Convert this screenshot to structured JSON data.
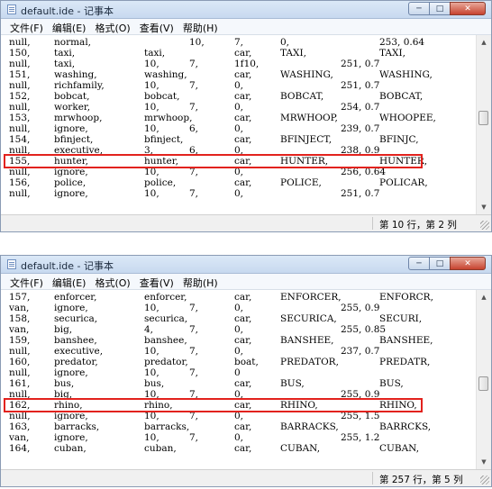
{
  "windows": [
    {
      "title": "default.ide - 记事本",
      "menu": [
        "文件(F)",
        "编辑(E)",
        "格式(O)",
        "查看(V)",
        "帮助(H)"
      ],
      "status": "第 10 行，第 2 列",
      "highlight_row_index": 11,
      "rows": [
        [
          "null,",
          "normal,",
          "",
          "10,",
          "7,",
          "0,",
          "",
          "",
          "253, 0.64"
        ],
        [
          "150,",
          "taxi,",
          "taxi,",
          "car,",
          "TAXI,",
          "TAXI,"
        ],
        [
          "null,",
          "taxi,",
          "10,",
          "7,",
          "1f10,",
          "251, 0.7"
        ],
        [
          "151,",
          "washing,",
          "washing,",
          "car,",
          "WASHING,",
          "WASHING,"
        ],
        [
          "null,",
          "richfamily,",
          "10,",
          "7,",
          "0,",
          "251, 0.7"
        ],
        [
          "152,",
          "bobcat,",
          "bobcat,",
          "car,",
          "BOBCAT,",
          "BOBCAT,"
        ],
        [
          "null,",
          "worker,",
          "10,",
          "7,",
          "0,",
          "254, 0.7"
        ],
        [
          "153,",
          "mrwhoop,",
          "mrwhoop,",
          "car,",
          "MRWHOOP,",
          "WHOOPEE,"
        ],
        [
          "null,",
          "ignore,",
          "10,",
          "6,",
          "0,",
          "239, 0.7"
        ],
        [
          "154,",
          "bfinject,",
          "bfinject,",
          "car,",
          "BFINJECT,",
          "BFINJC,"
        ],
        [
          "null,",
          "executive,",
          "3,",
          "6,",
          "0,",
          "238, 0.9"
        ],
        [
          "155,",
          "hunter,",
          "hunter,",
          "car,",
          "HUNTER,",
          "HUNTER,"
        ],
        [
          "null,",
          "ignore,",
          "10,",
          "7,",
          "0,",
          "256, 0.64"
        ],
        [
          "156,",
          "police,",
          "police,",
          "car,",
          "POLICE,",
          "POLICAR,"
        ],
        [
          "null,",
          "ignore,",
          "10,",
          "7,",
          "0,",
          "251, 0.7"
        ]
      ]
    },
    {
      "title": "default.ide - 记事本",
      "menu": [
        "文件(F)",
        "编辑(E)",
        "格式(O)",
        "查看(V)",
        "帮助(H)"
      ],
      "status": "第 257 行，第 5 列",
      "highlight_row_index": 10,
      "rows": [
        [
          "157,",
          "enforcer,",
          "enforcer,",
          "car,",
          "ENFORCER,",
          "ENFORCR,"
        ],
        [
          "van,",
          "ignore,",
          "10,",
          "7,",
          "0,",
          "255, 0.9"
        ],
        [
          "158,",
          "securica,",
          "securica,",
          "car,",
          "SECURICA,",
          "SECURI,"
        ],
        [
          "van,",
          "big,",
          "4,",
          "7,",
          "0,",
          "255, 0.85"
        ],
        [
          "159,",
          "banshee,",
          "banshee,",
          "car,",
          "BANSHEE,",
          "BANSHEE,"
        ],
        [
          "null,",
          "executive,",
          "10,",
          "7,",
          "0,",
          "237, 0.7"
        ],
        [
          "160,",
          "predator,",
          "predator,",
          "boat,",
          "PREDATOR,",
          "PREDATR,"
        ],
        [
          "null,",
          "ignore,",
          "10,",
          "7,",
          "0"
        ],
        [
          "161,",
          "bus,",
          "bus,",
          "car,",
          "BUS,",
          "BUS,"
        ],
        [
          "null,",
          "big,",
          "10,",
          "7,",
          "0,",
          "255, 0.9"
        ],
        [
          "162,",
          "rhino,",
          "rhino,",
          "car,",
          "RHINO,",
          "RHINO,"
        ],
        [
          "null,",
          "ignore,",
          "10,",
          "7,",
          "0,",
          "255, 1.5"
        ],
        [
          "163,",
          "barracks,",
          "barracks,",
          "car,",
          "BARRACKS,",
          "BARRCKS,"
        ],
        [
          "van,",
          "ignore,",
          "10,",
          "7,",
          "0,",
          "255, 1.2"
        ],
        [
          "164,",
          "cuban,",
          "cuban,",
          "car,",
          "CUBAN,",
          "CUBAN,"
        ]
      ]
    }
  ],
  "icons": {
    "app": "notepad-icon",
    "minimize": "minimize-icon",
    "maximize": "maximize-icon",
    "close": "close-icon",
    "up": "scroll-up-icon",
    "down": "scroll-down-icon"
  },
  "colors": {
    "highlight": "#e2221d",
    "titlebar": "#c7d9ef"
  }
}
